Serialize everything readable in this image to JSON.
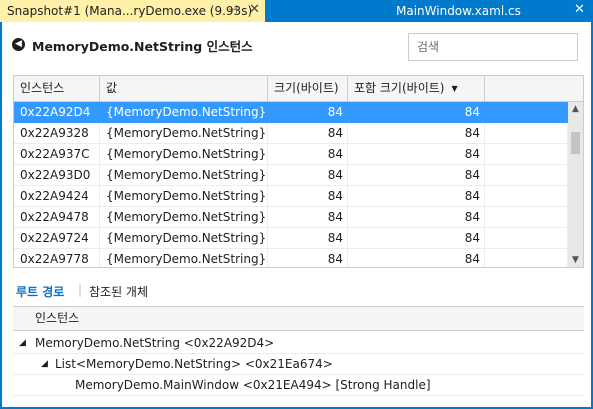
{
  "tabs": {
    "active": {
      "label": "Snapshot#1 (Mana...ryDemo.exe (9.93s)",
      "pin": "⊣",
      "close": "✕"
    },
    "inactive": {
      "label": "MainWindow.xaml.cs",
      "close": "✕"
    }
  },
  "header": {
    "title": "MemoryDemo.NetString 인스턴스",
    "search_placeholder": "검색"
  },
  "grid": {
    "columns": [
      "인스턴스",
      "값",
      "크기(바이트)",
      "포함 크기(바이트)"
    ],
    "sort_indicator": "▼",
    "rows": [
      {
        "instance": "0x22A92D4",
        "value": "{MemoryDemo.NetString}",
        "size": "84",
        "inclusive": "84",
        "selected": true
      },
      {
        "instance": "0x22A9328",
        "value": "{MemoryDemo.NetString}",
        "size": "84",
        "inclusive": "84"
      },
      {
        "instance": "0x22A937C",
        "value": "{MemoryDemo.NetString}",
        "size": "84",
        "inclusive": "84"
      },
      {
        "instance": "0x22A93D0",
        "value": "{MemoryDemo.NetString}",
        "size": "84",
        "inclusive": "84"
      },
      {
        "instance": "0x22A9424",
        "value": "{MemoryDemo.NetString}",
        "size": "84",
        "inclusive": "84"
      },
      {
        "instance": "0x22A9478",
        "value": "{MemoryDemo.NetString}",
        "size": "84",
        "inclusive": "84"
      },
      {
        "instance": "0x22A9724",
        "value": "{MemoryDemo.NetString}",
        "size": "84",
        "inclusive": "84"
      },
      {
        "instance": "0x22A9778",
        "value": "{MemoryDemo.NetString}",
        "size": "84",
        "inclusive": "84"
      }
    ]
  },
  "lower": {
    "tab_root": "루트 경로",
    "separator": "|",
    "tab_referenced": "참조된 개체",
    "column": "인스턴스",
    "tree": [
      {
        "text": "MemoryDemo.NetString   <0x22A92D4>",
        "arrow": "◢"
      },
      {
        "text": "List<MemoryDemo.NetString>   <0x21Ea674>",
        "arrow": "◢"
      },
      {
        "text": "MemoryDemo.MainWindow   <0x21EA494> [Strong Handle]",
        "arrow": ""
      }
    ]
  },
  "colors": {
    "accent": "#007acc",
    "active_tab": "#fff1a8",
    "selection": "#3399ff",
    "link": "#0e70c0"
  }
}
